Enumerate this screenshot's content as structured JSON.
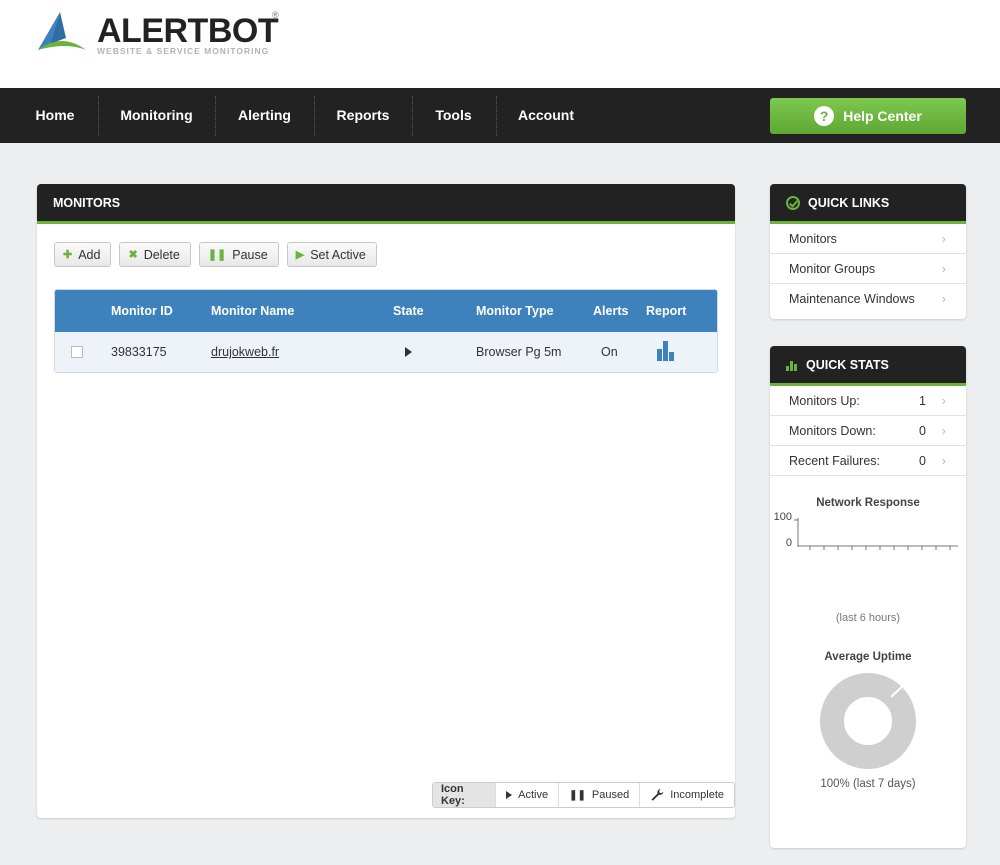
{
  "brand": {
    "name": "ALERTBOT",
    "tagline": "WEBSITE & SERVICE MONITORING",
    "registered": "®"
  },
  "nav": {
    "items": [
      "Home",
      "Monitoring",
      "Alerting",
      "Reports",
      "Tools",
      "Account"
    ],
    "help_label": "Help Center",
    "help_icon": "?"
  },
  "monitors": {
    "title": "MONITORS",
    "toolbar": {
      "add": "Add",
      "delete": "Delete",
      "pause": "Pause",
      "set_active": "Set Active"
    },
    "columns": [
      "Monitor ID",
      "Monitor Name",
      "State",
      "Monitor Type",
      "Alerts",
      "Report"
    ],
    "rows": [
      {
        "id": "39833175",
        "name": "drujokweb.fr",
        "state": "active",
        "type": "Browser Pg 5m",
        "alerts": "On"
      }
    ],
    "icon_key": {
      "label": "Icon Key:",
      "active": "Active",
      "paused": "Paused",
      "incomplete": "Incomplete"
    }
  },
  "quick_links": {
    "title": "QUICK LINKS",
    "items": [
      "Monitors",
      "Monitor Groups",
      "Maintenance Windows"
    ]
  },
  "quick_stats": {
    "title": "QUICK STATS",
    "items": [
      {
        "label": "Monitors Up:",
        "value": "1"
      },
      {
        "label": "Monitors Down:",
        "value": "0"
      },
      {
        "label": "Recent Failures:",
        "value": "0"
      }
    ],
    "network": {
      "title": "Network Response",
      "y_ticks": [
        "100",
        "0"
      ],
      "caption": "(last 6 hours)"
    },
    "uptime": {
      "title": "Average Uptime",
      "caption": "100% (last 7 days)",
      "percent": 100
    }
  },
  "colors": {
    "accent_green": "#6ab43e",
    "table_blue": "#3d82bd",
    "nav_dark": "#222222"
  }
}
